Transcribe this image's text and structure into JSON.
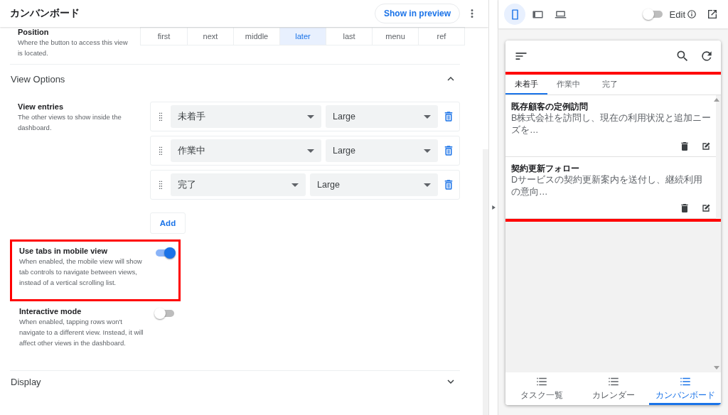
{
  "header": {
    "title": "カンバンボード",
    "preview_button": "Show in preview"
  },
  "position": {
    "label": "Position",
    "description": "Where the button to access this view is located.",
    "options": [
      {
        "label": "first",
        "selected": false
      },
      {
        "label": "next",
        "selected": false
      },
      {
        "label": "middle",
        "selected": false
      },
      {
        "label": "later",
        "selected": true
      },
      {
        "label": "last",
        "selected": false
      },
      {
        "label": "menu",
        "selected": false
      },
      {
        "label": "ref",
        "selected": false
      }
    ]
  },
  "view_options": {
    "title": "View Options",
    "expanded": true,
    "entries_label": "View entries",
    "entries_description": "The other views to show inside the dashboard.",
    "entries": [
      {
        "view": "未着手",
        "size": "Large"
      },
      {
        "view": "作業中",
        "size": "Large"
      },
      {
        "view": "完了",
        "size": "Large"
      }
    ],
    "add_button": "Add"
  },
  "settings": [
    {
      "label": "Use tabs in mobile view",
      "description": "When enabled, the mobile view will show tab controls to navigate between views, instead of a vertical scrolling list.",
      "on": true,
      "highlighted": true
    },
    {
      "label": "Interactive mode",
      "description": "When enabled, tapping rows won't navigate to a different view. Instead, it will affect other views in the dashboard.",
      "on": false,
      "highlighted": false
    }
  ],
  "display": {
    "title": "Display",
    "expanded": false
  },
  "preview": {
    "devices": [
      {
        "kind": "phone",
        "selected": true
      },
      {
        "kind": "tablet",
        "selected": false
      },
      {
        "kind": "desktop",
        "selected": false
      }
    ],
    "edit": {
      "label": "Edit",
      "on": false
    },
    "highlighted": true,
    "tabs": [
      {
        "label": "未着手",
        "selected": true
      },
      {
        "label": "作業中",
        "selected": false
      },
      {
        "label": "完了",
        "selected": false
      }
    ],
    "cards": [
      {
        "title": "既存顧客の定例訪問",
        "text": "B株式会社を訪問し、現在の利用状況と追加ニーズを…"
      },
      {
        "title": "契約更新フォロー",
        "text": "Dサービスの契約更新案内を送付し、継続利用の意向…"
      }
    ],
    "nav": [
      {
        "label": "タスク一覧",
        "selected": false
      },
      {
        "label": "カレンダー",
        "selected": false
      },
      {
        "label": "カンバンボード",
        "selected": true
      }
    ]
  }
}
